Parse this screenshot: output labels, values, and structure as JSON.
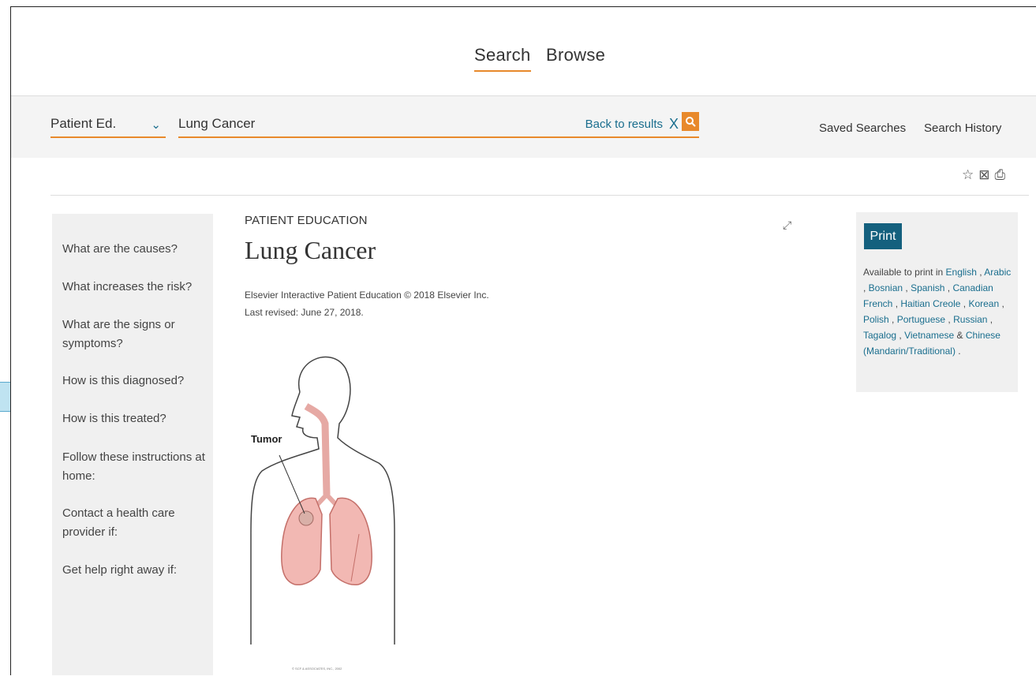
{
  "nav": {
    "tabs": [
      {
        "label": "Search"
      },
      {
        "label": "Browse"
      }
    ]
  },
  "search": {
    "category": "Patient Ed.",
    "query": "Lung Cancer",
    "back_label": "Back to results",
    "clear_glyph": "X",
    "saved_searches": "Saved Searches",
    "search_history": "Search History"
  },
  "toc": [
    {
      "label": "What are the causes?"
    },
    {
      "label": "What increases the risk?"
    },
    {
      "label": "What are the signs or symptoms?"
    },
    {
      "label": "How is this diagnosed?"
    },
    {
      "label": "How is this treated?"
    },
    {
      "label": "Follow these instructions at home:"
    },
    {
      "label": "Contact a health care provider if:"
    },
    {
      "label": "Get help right away if:"
    }
  ],
  "article": {
    "eyebrow": "PATIENT EDUCATION",
    "title": "Lung Cancer",
    "publisher": "Elsevier Interactive Patient Education © 2018 Elsevier Inc.",
    "revised": "Last revised: June 27, 2018.",
    "illustration_label": "Tumor",
    "illustration_credit": "© SCF & ASSOCIATES, INC., 2002"
  },
  "print": {
    "button": "Print",
    "intro": "Available to print in",
    "languages": [
      "English",
      "Arabic",
      "Bosnian",
      "Spanish",
      "Canadian French",
      "Haitian Creole",
      "Korean",
      "Polish",
      "Portuguese",
      "Russian",
      "Tagalog",
      "Vietnamese",
      "Chinese (Mandarin/Traditional)"
    ]
  },
  "colors": {
    "accent": "#e8892b",
    "link": "#1a6e8e",
    "button": "#14607e",
    "panel": "#f0f0f0"
  }
}
